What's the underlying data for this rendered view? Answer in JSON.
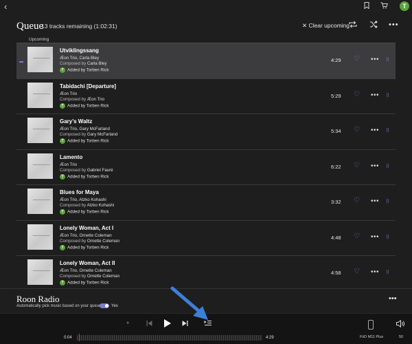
{
  "topbar": {
    "back_icon": "‹",
    "bookmark_icon": "bookmark-icon",
    "cart_icon": "cart-icon",
    "avatar_letter": "T"
  },
  "header": {
    "title": "Queue",
    "subtitle": "13 tracks remaining (1:02:31)",
    "clear_label": "✕ Clear upcoming"
  },
  "section_label": "Upcoming",
  "tracks": [
    {
      "title": "Utviklingssang",
      "artist": "Æon Trio, Carla Bley",
      "composer_prefix": "Composed by ",
      "composer": "Carla Bley",
      "added": "Added by Torben Rick",
      "duration": "4:29",
      "current": true
    },
    {
      "title": "Tabidachi [Departure]",
      "artist": "Æon Trio",
      "composer_prefix": "Composed by ",
      "composer": "Æon Trio",
      "added": "Added by Torben Rick",
      "duration": "5:29",
      "current": false
    },
    {
      "title": "Gary's Waltz",
      "artist": "Æon Trio, Gary McFarland",
      "composer_prefix": "Composed by ",
      "composer": "Gary McFarland",
      "added": "Added by Torben Rick",
      "duration": "5:34",
      "current": false
    },
    {
      "title": "Lamento",
      "artist": "Æon Trio",
      "composer_prefix": "Composed by ",
      "composer": "Gabriel Fauré",
      "added": "Added by Torben Rick",
      "duration": "6:22",
      "current": false
    },
    {
      "title": "Blues for Maya",
      "artist": "Æon Trio, Atzko Kohashi",
      "composer_prefix": "Composed by ",
      "composer": "Atzko Kohashi",
      "added": "Added by Torben Rick",
      "duration": "3:32",
      "current": false
    },
    {
      "title": "Lonely Woman, Act I",
      "artist": "Æon Trio, Ornette Coleman",
      "composer_prefix": "Composed by ",
      "composer": "Ornette Coleman",
      "added": "Added by Torben Rick",
      "duration": "4:48",
      "current": false
    },
    {
      "title": "Lonely Woman, Act II",
      "artist": "Æon Trio, Ornette Coleman",
      "composer_prefix": "Composed by ",
      "composer": "Ornette Coleman",
      "added": "Added by Torben Rick",
      "duration": "4:58",
      "current": false
    }
  ],
  "radio": {
    "title": "Roon Radio",
    "description": "Automatically pick music based on your queue",
    "toggle_label": "Yes",
    "enabled": true
  },
  "player": {
    "position": "0:04",
    "length": "4:29",
    "zone_name": "FiiO M11 Plus",
    "volume": "50"
  },
  "colors": {
    "accent": "#7b7bd6",
    "background": "#1e1e1e",
    "current_row": "#3c3c3e",
    "annotation_arrow": "#3d7fd6"
  }
}
